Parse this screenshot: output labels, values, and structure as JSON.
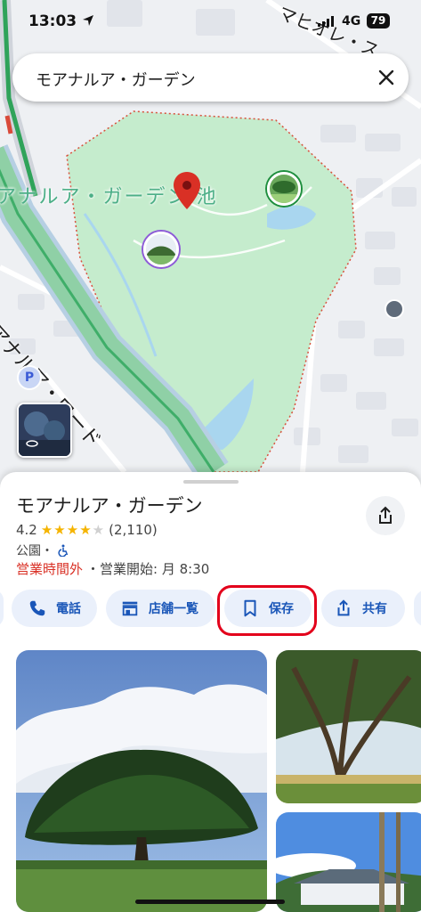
{
  "status_bar": {
    "time": "13:03",
    "network": "4G",
    "battery": "79"
  },
  "search": {
    "query": "モアナルア・ガーデン"
  },
  "map": {
    "area_label": "アナルア・ガーデン 池",
    "road_label": "モアナルア・ロード",
    "top_road_label": "マヒオレ・ス",
    "parking_label": "P"
  },
  "place": {
    "name": "モアナルア・ガーデン",
    "rating": "4.2",
    "stars": "★★★★",
    "star_empty": "★",
    "review_count": "(2,110)",
    "category": "公園・",
    "closed_status": "営業時間外",
    "opening_info": "・営業開始: 月 8:30"
  },
  "actions": [
    {
      "label": "電話",
      "icon": "phone-icon"
    },
    {
      "label": "店舗一覧",
      "icon": "storefront-icon"
    },
    {
      "label": "保存",
      "icon": "bookmark-icon"
    },
    {
      "label": "共有",
      "icon": "share-icon"
    }
  ],
  "colors": {
    "accent": "#1a56b8",
    "chip_bg": "#eaf0fb",
    "closed": "#d93025",
    "highlight": "#e3001b",
    "park": "#c5eccd"
  }
}
